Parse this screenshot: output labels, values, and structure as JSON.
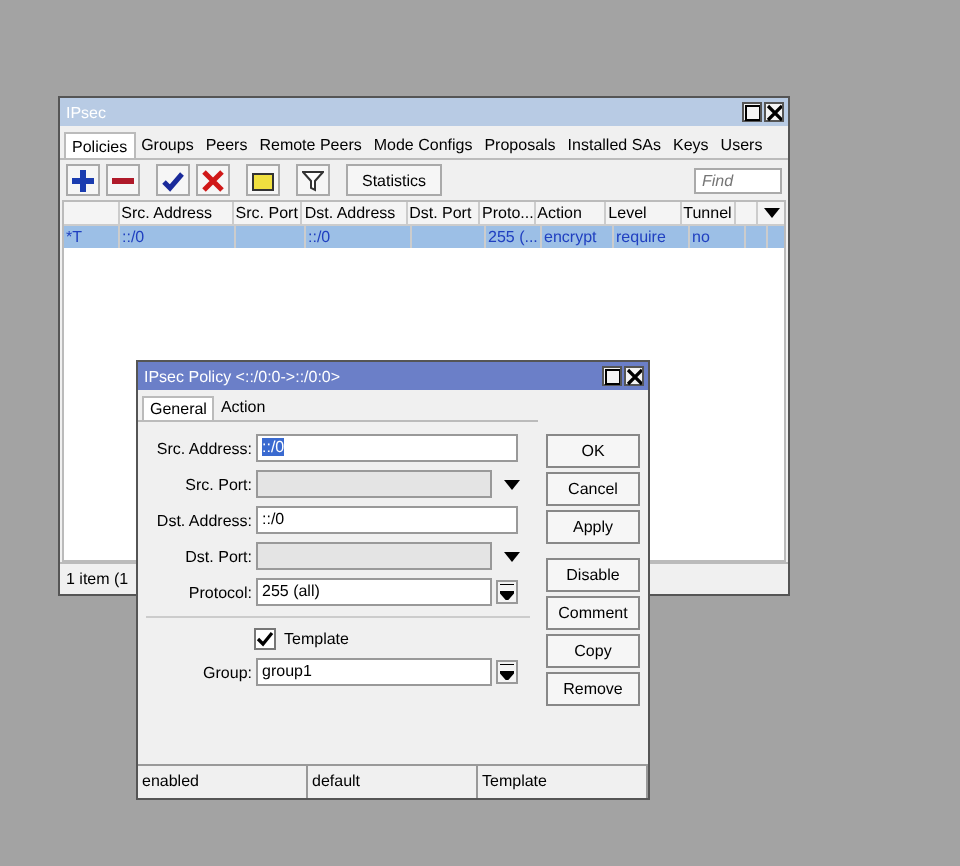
{
  "main_window": {
    "title": "IPsec",
    "tabs": [
      {
        "label": "Policies",
        "selected": true
      },
      {
        "label": "Groups",
        "selected": false
      },
      {
        "label": "Peers",
        "selected": false
      },
      {
        "label": "Remote Peers",
        "selected": false
      },
      {
        "label": "Mode Configs",
        "selected": false
      },
      {
        "label": "Proposals",
        "selected": false
      },
      {
        "label": "Installed SAs",
        "selected": false
      },
      {
        "label": "Keys",
        "selected": false
      },
      {
        "label": "Users",
        "selected": false
      }
    ],
    "toolbar": [
      {
        "kind": "add"
      },
      {
        "kind": "remove"
      },
      {
        "kind": "enable"
      },
      {
        "kind": "disable"
      },
      {
        "kind": "comment"
      },
      {
        "kind": "filter"
      },
      {
        "kind": "text",
        "label": "Statistics"
      }
    ],
    "find": {
      "placeholder": "Find"
    },
    "table": {
      "columns": [
        "",
        "Src. Address",
        "Src. Port",
        "Dst. Address",
        "Dst. Port",
        "Proto...",
        "Action",
        "Level",
        "Tunnel",
        ""
      ],
      "rows": [
        {
          "selected": true,
          "cells": [
            "*T",
            "::/0",
            "",
            "::/0",
            "",
            "255 (...",
            "encrypt",
            "require",
            "no",
            ""
          ]
        }
      ]
    },
    "status_bar": "1 item (1"
  },
  "dialog": {
    "title": "IPsec Policy <::/0:0->::/0:0>",
    "tabs": [
      {
        "label": "General",
        "selected": true
      },
      {
        "label": "Action",
        "selected": false
      }
    ],
    "fields": [
      {
        "label": "Src. Address:",
        "value": "::/0",
        "kind": "text",
        "disabled": false,
        "value_selected": true
      },
      {
        "label": "Src. Port:",
        "kind": "dropdown",
        "disabled": true
      },
      {
        "label": "Dst. Address:",
        "value": "::/0",
        "kind": "text",
        "disabled": false,
        "value_selected": false
      },
      {
        "label": "Dst. Port:",
        "kind": "dropdown",
        "disabled": true
      },
      {
        "label": "Protocol:",
        "value": "255 (all)",
        "kind": "combo",
        "disabled": false,
        "value_selected": false
      }
    ],
    "template": {
      "label": "Template",
      "checked": true
    },
    "group": {
      "label": "Group:",
      "value": "group1",
      "kind": "combo"
    },
    "buttons": [
      "OK",
      "Cancel",
      "Apply",
      "Disable",
      "Comment",
      "Copy",
      "Remove"
    ],
    "status_bar": [
      "enabled",
      "default",
      "Template"
    ]
  }
}
